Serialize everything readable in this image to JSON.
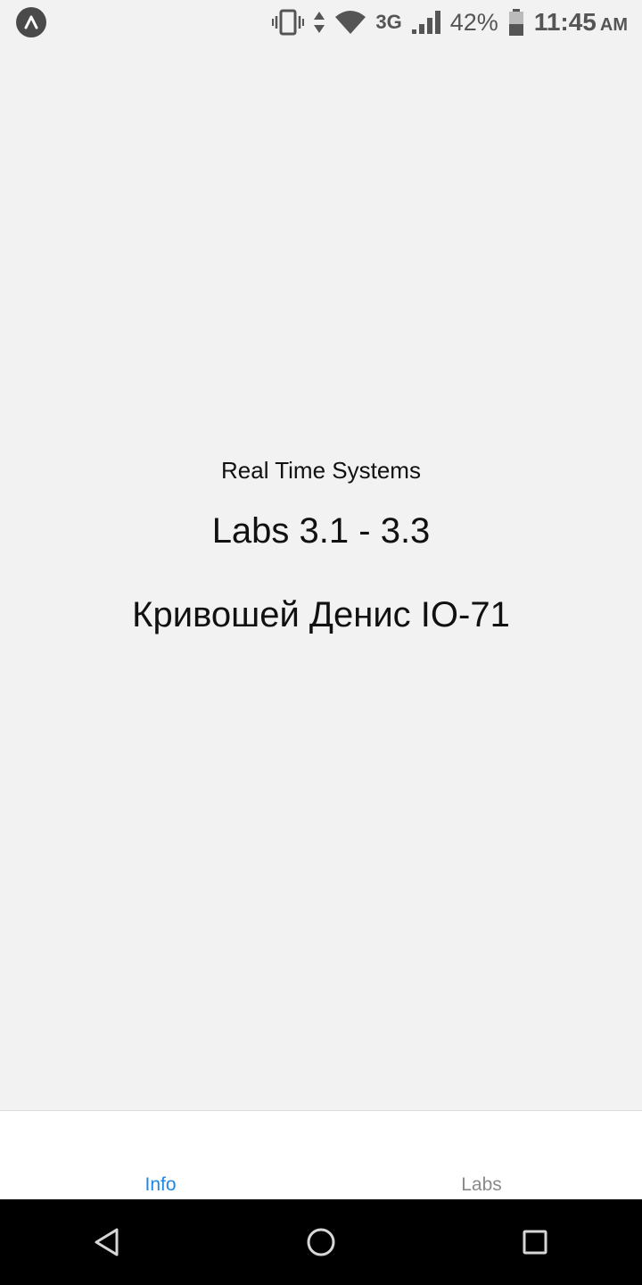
{
  "status_bar": {
    "network": "3G",
    "battery_percent": "42%",
    "time": "11:45",
    "ampm": "AM",
    "icons": [
      "app-indicator-icon",
      "vibrate-icon",
      "data-arrows-icon",
      "wifi-icon",
      "signal-icon",
      "battery-icon"
    ]
  },
  "main": {
    "subject": "Real Time Systems",
    "labs": "Labs 3.1 - 3.3",
    "author": "Кривошей Денис IO-71"
  },
  "tabs": [
    {
      "label": "Info",
      "active": true
    },
    {
      "label": "Labs",
      "active": false
    }
  ],
  "colors": {
    "background": "#f2f2f2",
    "active_tab": "#1e88e5",
    "inactive_tab": "#8a8a8a",
    "nav_bar": "#000000"
  },
  "nav_bar": {
    "icons": [
      "back-icon",
      "home-icon",
      "recents-icon"
    ]
  }
}
